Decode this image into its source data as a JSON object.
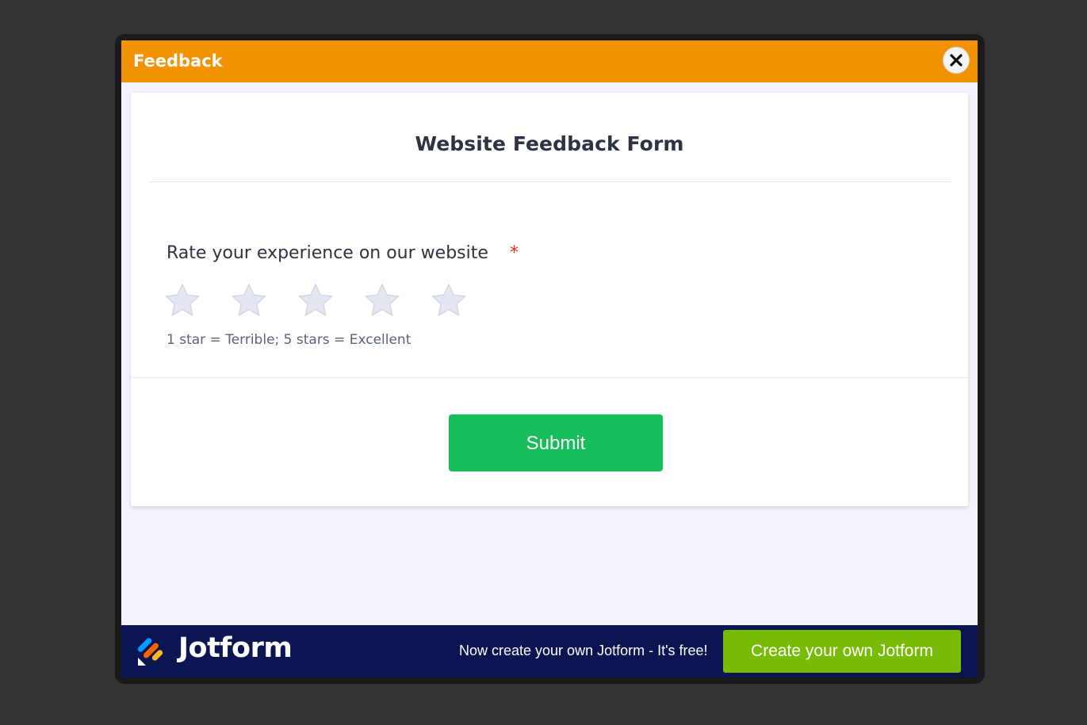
{
  "modal": {
    "title": "Feedback",
    "close_icon": "close-icon",
    "header_color": "#f39200"
  },
  "form": {
    "title": "Website Feedback Form",
    "question": {
      "label": "Rate your experience on our website",
      "required_marker": "*",
      "star_count": 5,
      "selected_rating": 0,
      "hint": "1 star = Terrible; 5 stars = Excellent",
      "star_icon": "star-icon",
      "star_color": "#e3e6f0"
    },
    "submit_label": "Submit",
    "submit_color": "#18bd5b"
  },
  "footer": {
    "brand": "Jotform",
    "logo_icon": "jotform-logo-icon",
    "promo_text": "Now create your own Jotform - It's free!",
    "cta_label": "Create your own Jotform",
    "background_color": "#0a1551",
    "cta_color": "#78bb07"
  }
}
